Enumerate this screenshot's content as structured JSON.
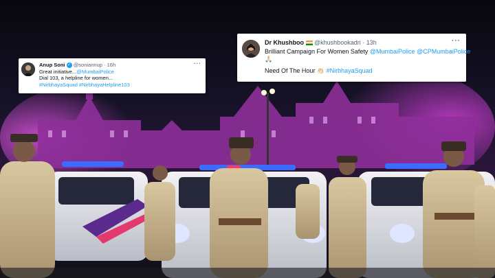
{
  "tweets": [
    {
      "name": "Anup Soni",
      "handle": "@soniannup",
      "time": "16h",
      "more": "···",
      "line1_text": "Great initiative...",
      "line1_link": "@MumbaiPolice",
      "line2": "Dial 103, a helpline for women...",
      "line3": "#NirbhayaSquad #NirbhayaHelpline103"
    },
    {
      "name": "Dr Khushboo",
      "handle": "@khushbookadri",
      "time": "13h",
      "more": "···",
      "line1_text": "Brilliant Campaign For Women Safety ",
      "line1_link1": "@MumbaiPolice",
      "line1_link2": "@CPMumbaiPolice",
      "line2_emoji": "🙏🏻",
      "line3_text": "Need Of The Hour 👏🏻 ",
      "line3_link": "#NirbhayaSquad"
    }
  ],
  "colors": {
    "link": "#1d9bf0",
    "muted": "#536471",
    "text": "#0f1419"
  }
}
